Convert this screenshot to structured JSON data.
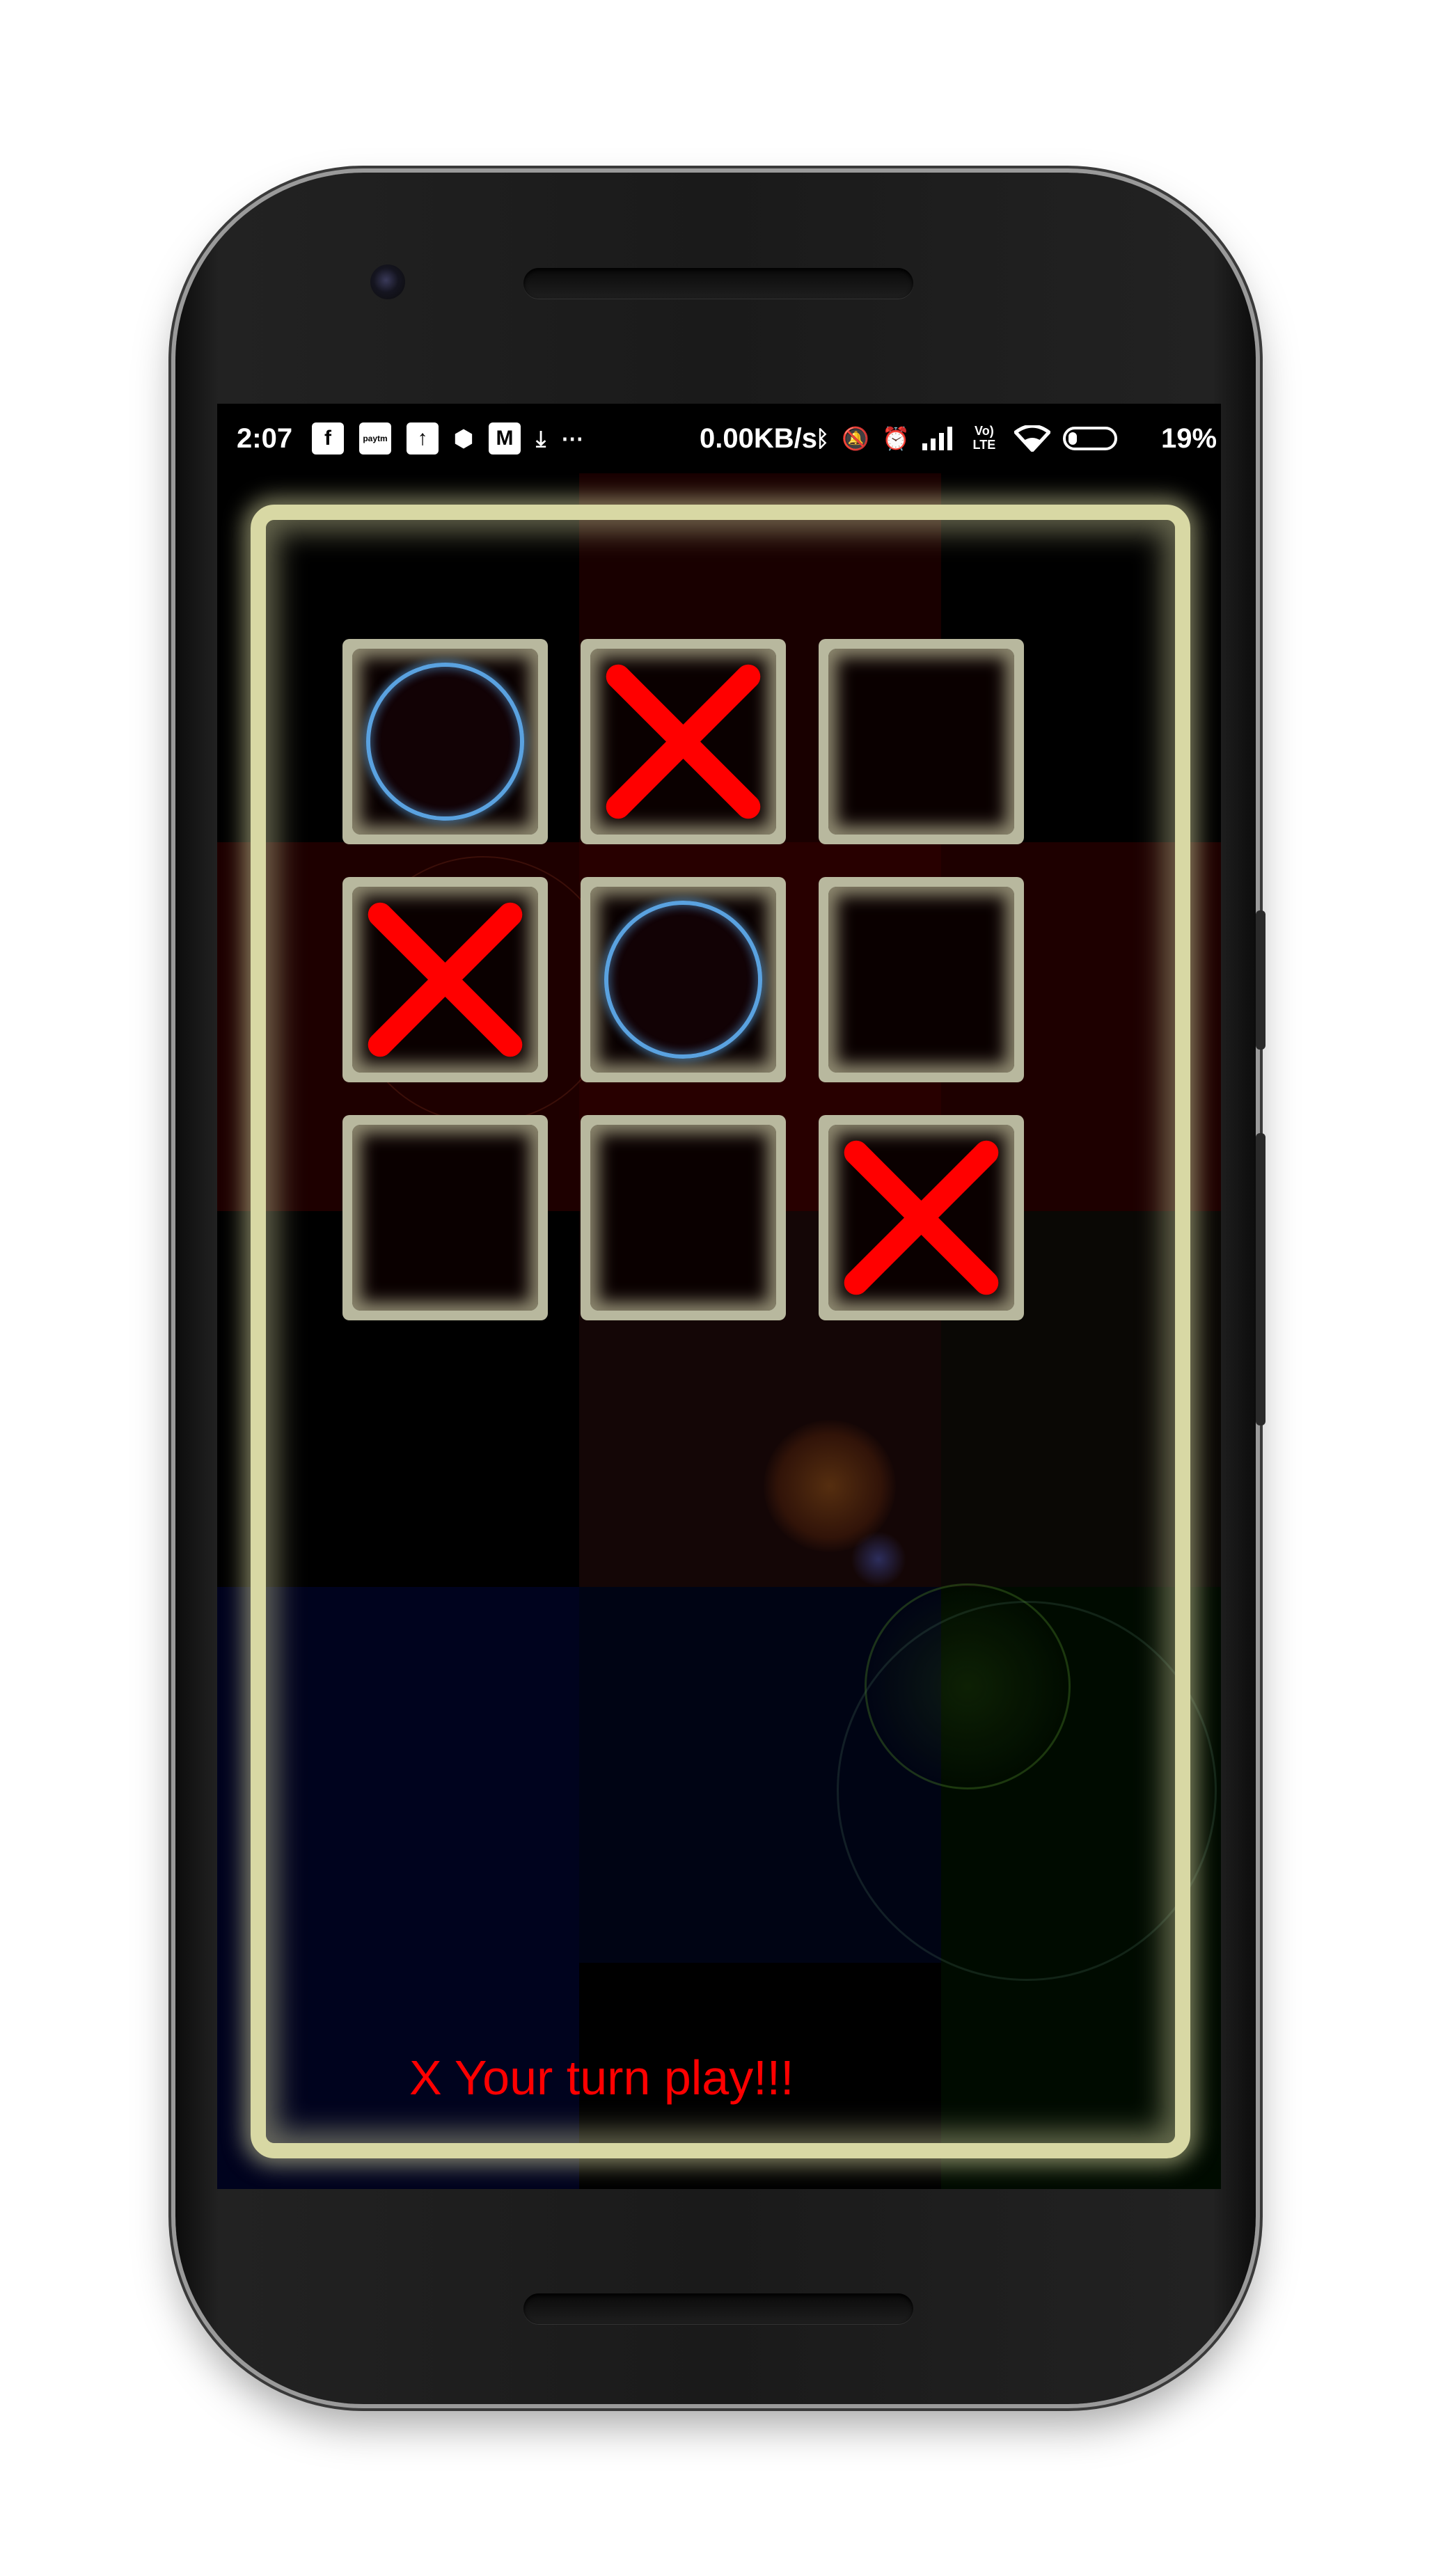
{
  "status_bar": {
    "time": "2:07",
    "left_icons": [
      "facebook-icon",
      "paytm-icon",
      "upload-icon",
      "app-icon",
      "gmail-icon",
      "download-icon",
      "more-icon"
    ],
    "paytm_label": "paytm",
    "net_speed": "0.00KB/s",
    "right_icons": [
      "bluetooth-icon",
      "mute-icon",
      "alarm-icon",
      "signal-icon",
      "volte-icon",
      "wifi-icon",
      "battery-icon"
    ],
    "volte_label": "Vo) LTE",
    "battery_percent": "19%",
    "battery_level": 0.19
  },
  "game": {
    "board": [
      [
        "O",
        "X",
        ""
      ],
      [
        "X",
        "O",
        ""
      ],
      [
        "",
        "",
        "X"
      ]
    ],
    "x_color": "#ff0000",
    "o_color": "#5aa2e0",
    "frame_color": "#d8d8a4",
    "turn_message": "X Your turn play!!!"
  }
}
